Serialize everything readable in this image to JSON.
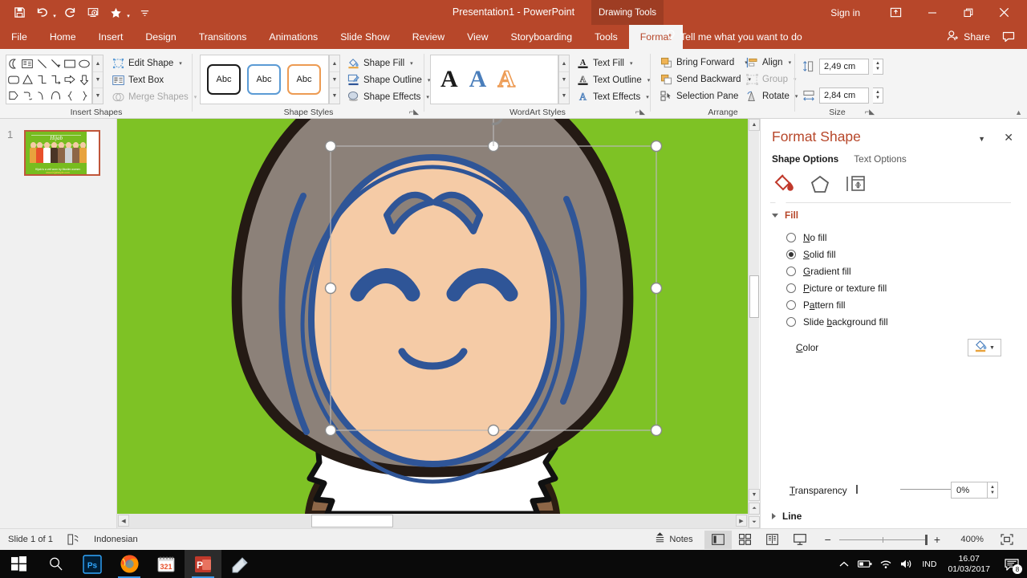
{
  "window": {
    "title": "Presentation1  -  PowerPoint",
    "contextual_tab_label": "Drawing Tools",
    "sign_in": "Sign in",
    "ribbon_display_icon": "ribbon-display-options-icon",
    "minimize_icon": "minimize-icon",
    "restore_icon": "restore-icon",
    "close_icon": "close-icon"
  },
  "quick_access": [
    {
      "name": "save-icon",
      "label": "Save",
      "has_caret": false
    },
    {
      "name": "undo-icon",
      "label": "Undo",
      "has_caret": true
    },
    {
      "name": "redo-icon",
      "label": "Redo",
      "has_caret": false
    },
    {
      "name": "start-from-beginning-icon",
      "label": "Start From Beginning",
      "has_caret": false
    },
    {
      "name": "touch-mode-icon",
      "label": "Favorites",
      "has_caret": true
    },
    {
      "name": "customize-qat-icon",
      "label": "Customize Quick Access Toolbar",
      "has_caret": false
    }
  ],
  "tabs": [
    {
      "label": "File",
      "active": false
    },
    {
      "label": "Home",
      "active": false
    },
    {
      "label": "Insert",
      "active": false
    },
    {
      "label": "Design",
      "active": false
    },
    {
      "label": "Transitions",
      "active": false
    },
    {
      "label": "Animations",
      "active": false
    },
    {
      "label": "Slide Show",
      "active": false
    },
    {
      "label": "Review",
      "active": false
    },
    {
      "label": "View",
      "active": false
    },
    {
      "label": "Storyboarding",
      "active": false
    },
    {
      "label": "Tools",
      "active": false
    },
    {
      "label": "Format",
      "active": true
    }
  ],
  "tell_me": {
    "placeholder": "Tell me what you want to do",
    "icon": "lightbulb-icon"
  },
  "share": {
    "label": "Share",
    "icon": "person-add-icon",
    "comments_icon": "comments-icon"
  },
  "ribbon": {
    "groups": [
      {
        "name": "insert-shapes",
        "label": "Insert Shapes"
      },
      {
        "name": "shape-styles",
        "label": "Shape Styles"
      },
      {
        "name": "wordart-styles",
        "label": "WordArt Styles"
      },
      {
        "name": "arrange",
        "label": "Arrange"
      },
      {
        "name": "size",
        "label": "Size"
      }
    ],
    "insert_shapes": {
      "commands": [
        {
          "label": "Edit Shape",
          "icon": "edit-shape-icon",
          "dropdown": true,
          "disabled": false
        },
        {
          "label": "Text Box",
          "icon": "text-box-icon",
          "dropdown": false,
          "disabled": false
        },
        {
          "label": "Merge Shapes",
          "icon": "merge-shapes-icon",
          "dropdown": true,
          "disabled": true
        }
      ]
    },
    "shape_styles": {
      "previews": [
        "Abc",
        "Abc",
        "Abc"
      ],
      "commands": [
        {
          "label": "Shape Fill",
          "icon": "shape-fill-icon",
          "dropdown": true
        },
        {
          "label": "Shape Outline",
          "icon": "shape-outline-icon",
          "dropdown": true
        },
        {
          "label": "Shape Effects",
          "icon": "shape-effects-icon",
          "dropdown": true
        }
      ]
    },
    "wordart_styles": {
      "previews": [
        "A",
        "A",
        "A"
      ],
      "commands": [
        {
          "label": "Text Fill",
          "icon": "text-fill-icon",
          "dropdown": true
        },
        {
          "label": "Text Outline",
          "icon": "text-outline-icon",
          "dropdown": true
        },
        {
          "label": "Text Effects",
          "icon": "text-effects-icon",
          "dropdown": true
        }
      ]
    },
    "arrange": {
      "commands_left": [
        {
          "label": "Bring Forward",
          "icon": "bring-forward-icon",
          "dropdown": true,
          "disabled": false
        },
        {
          "label": "Send Backward",
          "icon": "send-backward-icon",
          "dropdown": true,
          "disabled": false
        },
        {
          "label": "Selection Pane",
          "icon": "selection-pane-icon",
          "dropdown": false,
          "disabled": false
        }
      ],
      "commands_right": [
        {
          "label": "Align",
          "icon": "align-icon",
          "dropdown": true,
          "disabled": false
        },
        {
          "label": "Group",
          "icon": "group-icon",
          "dropdown": true,
          "disabled": true
        },
        {
          "label": "Rotate",
          "icon": "rotate-icon",
          "dropdown": true,
          "disabled": false
        }
      ]
    },
    "size": {
      "height": {
        "label": "Shape Height",
        "icon": "shape-height-icon",
        "value": "2,49 cm"
      },
      "width": {
        "label": "Shape Width",
        "icon": "shape-width-icon",
        "value": "2,84 cm"
      }
    }
  },
  "thumbnail_pane": {
    "slide_number": "1",
    "slide_title": "Hijab",
    "caption_line1": "Hijab is a veil worn by Muslim women",
    "caption_line2": "www.hijabstyle.com"
  },
  "slide": {
    "background_color": "#7ec225",
    "skin_color": "#f5cba6",
    "hijab_color": "#8c8179",
    "accent_color": "#2f5597",
    "flower_color": "#e8502a",
    "dress_color": "#8d6647",
    "collar_color": "#ffffff",
    "selection_rotate_icon": "rotate-handle-icon"
  },
  "format_pane": {
    "title": "Format Shape",
    "dropdown_icon": "pane-options-icon",
    "close_icon": "close-icon",
    "tabs": [
      {
        "label": "Shape Options",
        "active": true
      },
      {
        "label": "Text Options",
        "active": false
      }
    ],
    "icon_tabs": [
      {
        "name": "fill-and-line-icon",
        "active": true
      },
      {
        "name": "effects-icon",
        "active": false
      },
      {
        "name": "size-and-properties-icon",
        "active": false
      }
    ],
    "fill_section": {
      "label": "Fill",
      "expanded": true,
      "options": [
        {
          "label": "No fill",
          "accel": "N",
          "selected": false
        },
        {
          "label": "Solid fill",
          "accel": "S",
          "selected": true
        },
        {
          "label": "Gradient fill",
          "accel": "G",
          "selected": false
        },
        {
          "label": "Picture or texture fill",
          "accel": "P",
          "selected": false
        },
        {
          "label": "Pattern fill",
          "accel": "a",
          "selected": false
        },
        {
          "label": "Slide background fill",
          "accel": "b",
          "selected": false
        }
      ],
      "color": {
        "label": "Color",
        "accel": "C",
        "icon": "fill-color-icon"
      },
      "transparency": {
        "label": "Transparency",
        "accel": "T",
        "value": "0%",
        "percent": 0
      }
    },
    "line_section": {
      "label": "Line",
      "expanded": false
    }
  },
  "status_bar": {
    "slide_indicator": "Slide 1 of 1",
    "accessibility_icon": "accessibility-check-icon",
    "language": "Indonesian",
    "notes": {
      "label": "Notes",
      "icon": "notes-icon"
    },
    "views": [
      {
        "name": "normal-view-icon",
        "active": true
      },
      {
        "name": "slide-sorter-icon",
        "active": false
      },
      {
        "name": "reading-view-icon",
        "active": false
      },
      {
        "name": "slide-show-icon",
        "active": false
      }
    ],
    "zoom": {
      "out_label": "-",
      "in_label": "+",
      "level": "400%",
      "fit_icon": "fit-slide-icon"
    }
  },
  "taskbar": {
    "start_icon": "windows-start-icon",
    "search_icon": "search-icon",
    "apps": [
      {
        "name": "photoshop-icon",
        "label": "Ps",
        "running": false
      },
      {
        "name": "firefox-icon",
        "label": "",
        "running": true
      },
      {
        "name": "calendar-icon",
        "label": "321",
        "running": false
      },
      {
        "name": "powerpoint-icon",
        "label": "P",
        "running": true,
        "active": true
      },
      {
        "name": "sticky-notes-icon",
        "label": "",
        "running": false
      }
    ],
    "tray": [
      {
        "name": "show-hidden-icons-icon"
      },
      {
        "name": "battery-icon"
      },
      {
        "name": "wifi-icon"
      },
      {
        "name": "volume-icon"
      }
    ],
    "language_indicator": "IND",
    "time": "16.07",
    "date": "01/03/2017",
    "notifications": {
      "icon": "action-center-icon",
      "count": "8"
    }
  }
}
